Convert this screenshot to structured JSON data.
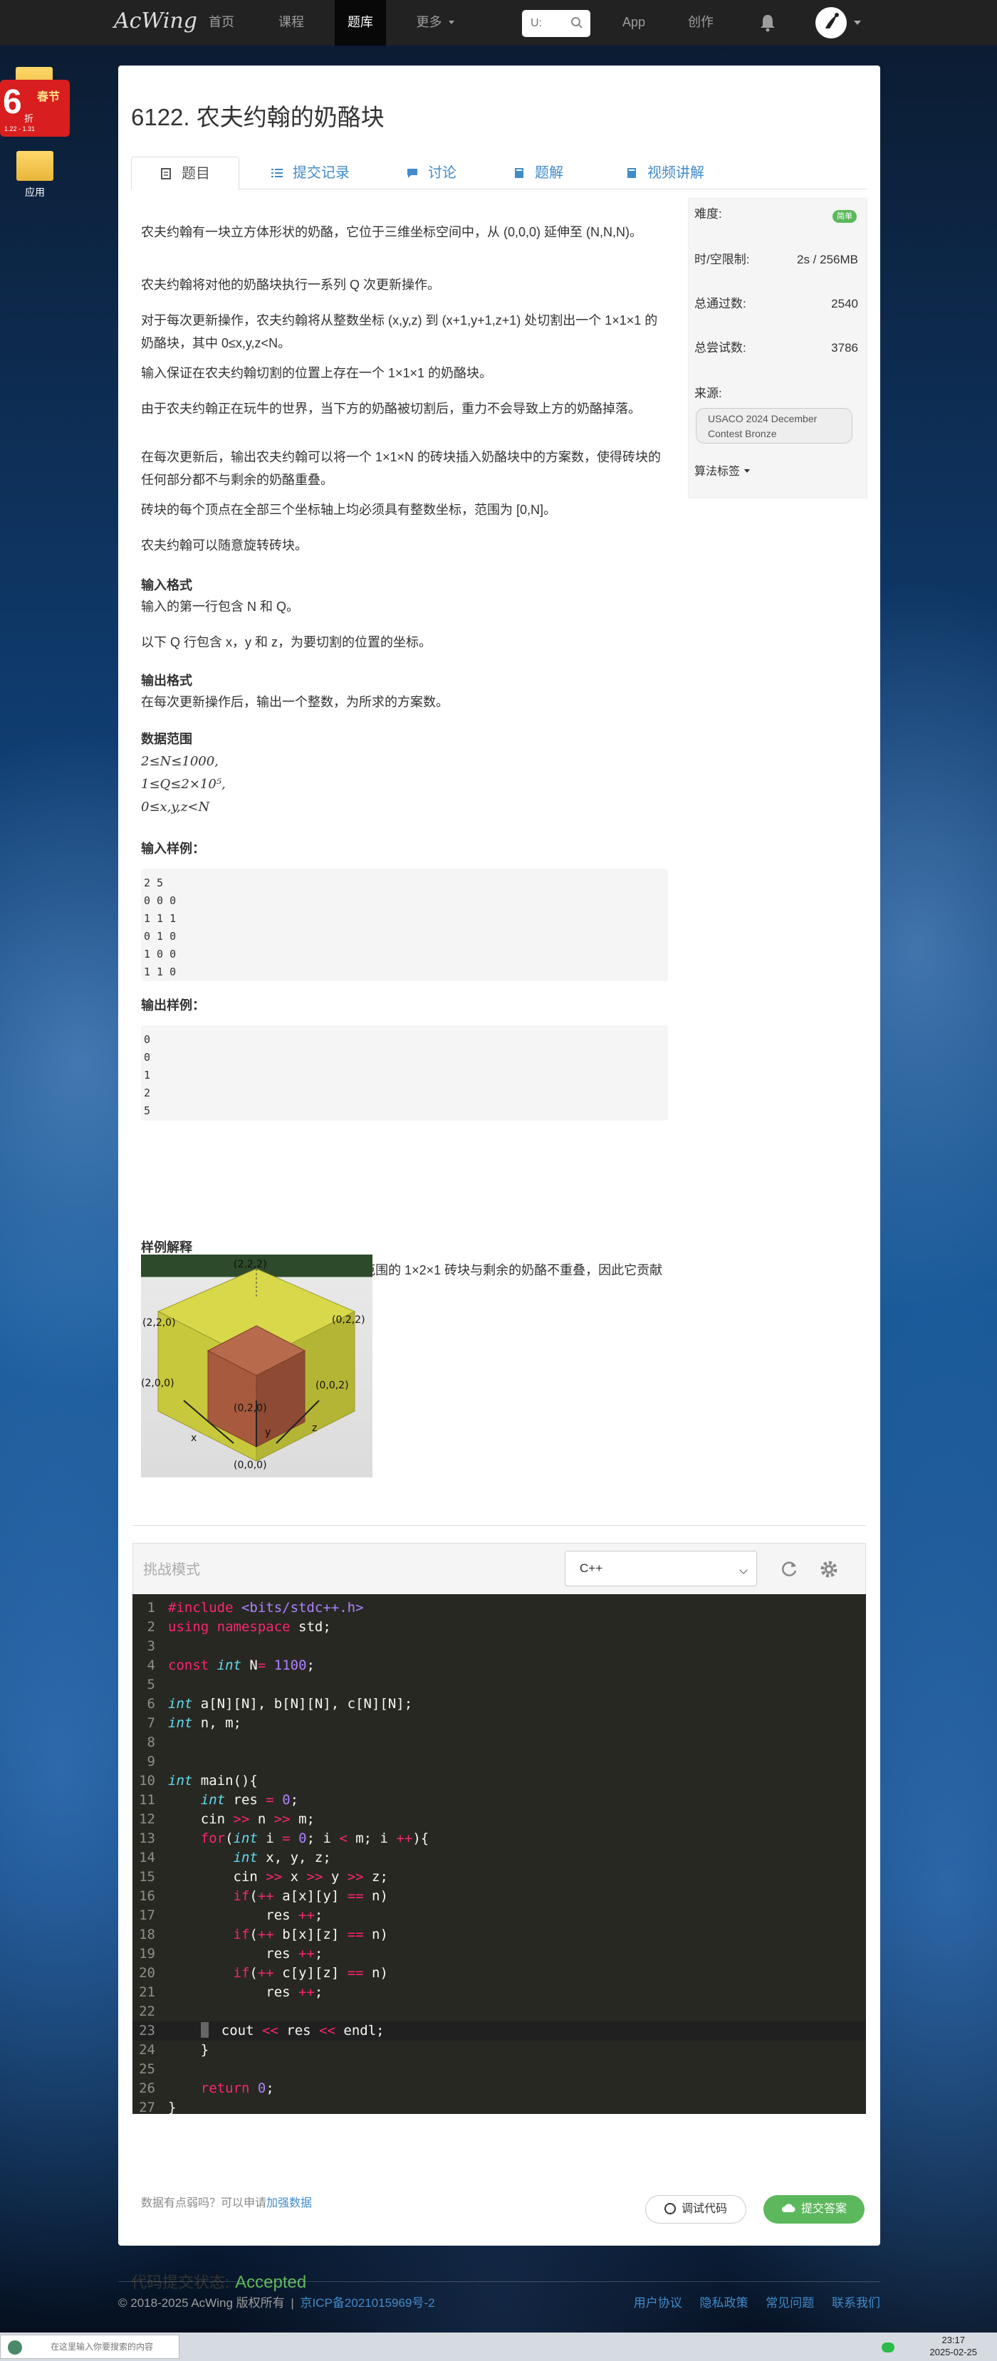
{
  "nav": {
    "logo": "AcWing",
    "items": [
      "首页",
      "课程",
      "题库",
      "更多",
      "App",
      "创作"
    ],
    "search_placeholder": "U:"
  },
  "desktop": {
    "badge_big": "6",
    "badge_small": "春节",
    "badge_side": "折",
    "badge_dates": "1.22 - 1.31",
    "app_label": "应用"
  },
  "problem": {
    "title": "6122. 农夫约翰的奶酪块",
    "tabs": [
      "题目",
      "提交记录",
      "讨论",
      "题解",
      "视频讲解"
    ],
    "desc": [
      "农夫约翰有一块立方体形状的奶酪，它位于三维坐标空间中，从 (0,0,0) 延伸至 (N,N,N)。",
      "农夫约翰将对他的奶酪块执行一系列 Q 次更新操作。",
      "对于每次更新操作，农夫约翰将从整数坐标 (x,y,z) 到 (x+1,y+1,z+1) 处切割出一个 1×1×1 的奶酪块，其中 0≤x,y,z<N。",
      "输入保证在农夫约翰切割的位置上存在一个 1×1×1 的奶酪块。",
      "由于农夫约翰正在玩牛的世界，当下方的奶酪被切割后，重力不会导致上方的奶酪掉落。",
      "在每次更新后，输出农夫约翰可以将一个 1×1×N 的砖块插入奶酪块中的方案数，使得砖块的任何部分都不与剩余的奶酪重叠。",
      "砖块的每个顶点在全部三个坐标轴上均必须具有整数坐标，范围为 [0,N]。",
      "农夫约翰可以随意旋转砖块。"
    ],
    "input_format_title": "输入格式",
    "input_format": [
      "输入的第一行包含 N 和 Q。",
      "以下 Q 行包含 x，y 和 z，为要切割的位置的坐标。"
    ],
    "output_format_title": "输出格式",
    "output_format": "在每次更新操作后，输出一个整数，为所求的方案数。",
    "range_title": "数据范围",
    "range": [
      "2≤N≤1000,",
      "1≤Q≤2×10⁵,",
      "0≤x,y,z<N"
    ],
    "sample_in_title": "输入样例：",
    "sample_in": "2 5\n0 0 0\n1 1 1\n0 1 0\n1 0 0\n1 1 0",
    "sample_out_title": "输出样例：",
    "sample_out": "0\n0\n1\n2\n5",
    "explain_title": "样例解释",
    "explain": "在前三次更新操作后，[0,1]×[0,2]×[0,1] 范围的 1×2×1 砖块与剩余的奶酪不重叠，因此它贡献了答案。",
    "figure_labels": [
      "(2,2,2)",
      "(2,2,0)",
      "(0,2,2)",
      "(2,0,0)",
      "(0,0,2)",
      "(0,2,0)",
      "x",
      "y",
      "z",
      "(0,0,0)"
    ]
  },
  "sidebar": {
    "difficulty_label": "难度:",
    "difficulty": "简单",
    "limit_label": "时/空限制:",
    "limit": "2s / 256MB",
    "passed_label": "总通过数:",
    "passed": "2540",
    "attempts_label": "总尝试数:",
    "attempts": "3786",
    "source_label": "来源:",
    "source": "USACO 2024 December Contest Bronze",
    "tags_label": "算法标签"
  },
  "editor": {
    "mode": "挑战模式",
    "language": "C++",
    "lines": [
      "#include <bits/stdc++.h>",
      "using namespace std;",
      "",
      "const int N= 1100;",
      "",
      "int a[N][N], b[N][N], c[N][N];",
      "int n, m;",
      "",
      "",
      "int main(){",
      "    int res = 0;",
      "    cin >> n >> m;",
      "    for(int i = 0; i < m; i ++){",
      "        int x, y, z;",
      "        cin >> x >> y >> z;",
      "        if(++ a[x][y] == n)",
      "            res ++;",
      "        if(++ b[x][z] == n)",
      "            res ++;",
      "        if(++ c[y][z] == n)",
      "            res ++;",
      "",
      "        cout << res << endl;",
      "    }",
      "",
      "    return 0;",
      "}"
    ],
    "hint_text": "数据有点弱吗？可以申请",
    "hint_link": "加强数据",
    "debug_button": "调试代码",
    "submit_button": "提交答案"
  },
  "status": {
    "label": "代码提交状态:",
    "value": "Accepted"
  },
  "footer": {
    "copyright": "© 2018-2025 AcWing 版权所有",
    "icp": "京ICP备2021015969号-2",
    "links": [
      "用户协议",
      "隐私政策",
      "常见问题",
      "联系我们"
    ]
  },
  "taskbar": {
    "search_placeholder": "在这里输入你要搜索的内容",
    "time": "23:17",
    "date": "2025-02-25"
  },
  "colors": {
    "accent": "#428bca",
    "success": "#5cb85c",
    "nav_bg": "#222222",
    "code_bg": "#272822"
  }
}
